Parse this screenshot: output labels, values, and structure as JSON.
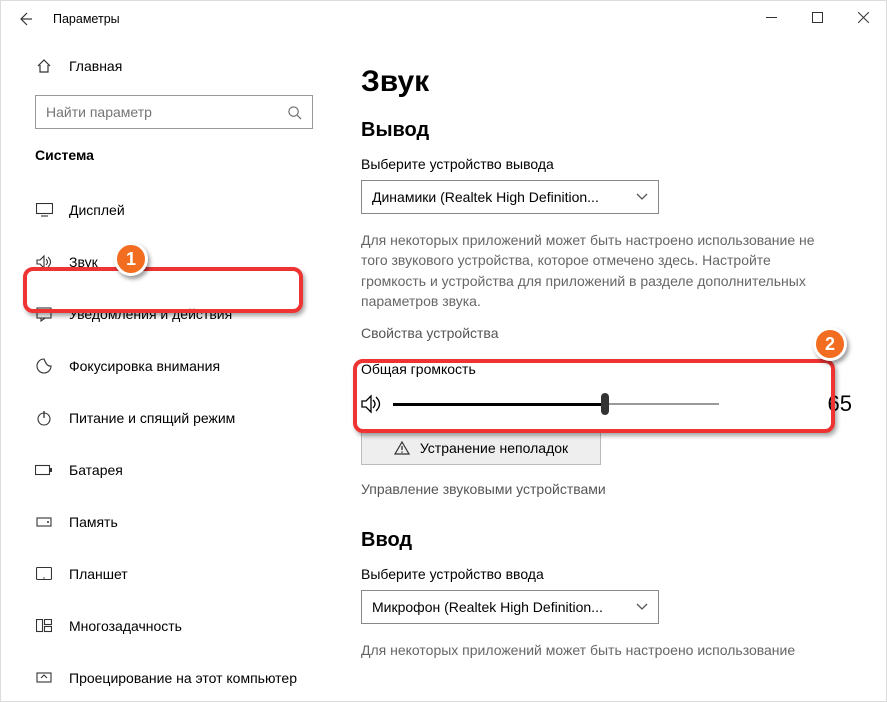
{
  "window": {
    "title": "Параметры"
  },
  "sidebar": {
    "home": "Главная",
    "search_placeholder": "Найти параметр",
    "section": "Система",
    "items": [
      {
        "label": "Дисплей"
      },
      {
        "label": "Звук"
      },
      {
        "label": "Уведомления и действия"
      },
      {
        "label": "Фокусировка внимания"
      },
      {
        "label": "Питание и спящий режим"
      },
      {
        "label": "Батарея"
      },
      {
        "label": "Память"
      },
      {
        "label": "Планшет"
      },
      {
        "label": "Многозадачность"
      },
      {
        "label": "Проецирование на этот компьютер"
      }
    ]
  },
  "main": {
    "title": "Звук",
    "output": {
      "heading": "Вывод",
      "choose_label": "Выберите устройство вывода",
      "device": "Динамики (Realtek High Definition...",
      "desc": "Для некоторых приложений может быть настроено использование не того звукового устройства, которое отмечено здесь. Настройте громкость и устройства для приложений в разделе дополнительных параметров звука.",
      "device_props": "Свойства устройства",
      "volume_label": "Общая громкость",
      "volume_value": "65",
      "troubleshoot": "Устранение неполадок",
      "manage": "Управление звуковыми устройствами"
    },
    "input": {
      "heading": "Ввод",
      "choose_label": "Выберите устройство ввода",
      "device": "Микрофон (Realtek High Definition...",
      "desc": "Для некоторых приложений может быть настроено использование"
    }
  },
  "badges": {
    "one": "1",
    "two": "2"
  }
}
